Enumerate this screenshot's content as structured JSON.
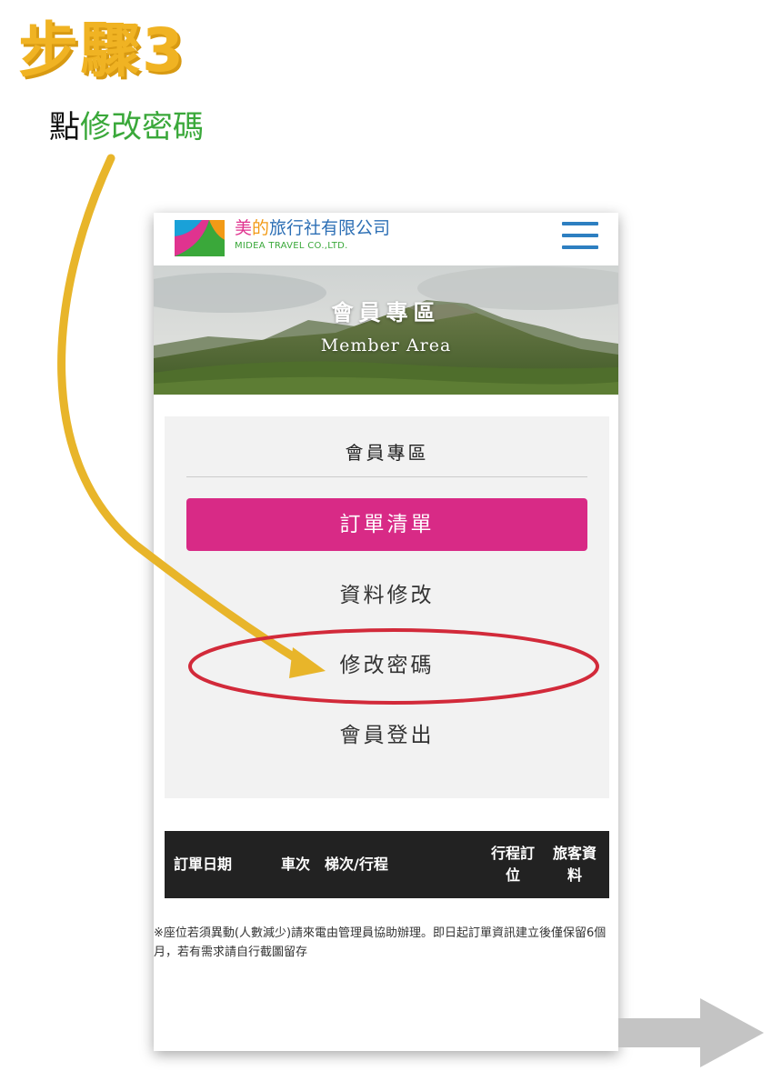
{
  "step": {
    "title": "步驟3"
  },
  "instruction": {
    "prefix": "點",
    "highlight": "修改密碼"
  },
  "header": {
    "brand_part1": "美",
    "brand_part2": "的",
    "brand_part3": "旅行社有限公司",
    "brand_en": "MIDEA TRAVEL  CO.,LTD.",
    "menu_icon": "hamburger-menu-icon"
  },
  "hero": {
    "title": "會員專區",
    "subtitle": "Member Area"
  },
  "member_menu": {
    "heading": "會員專區",
    "items": [
      {
        "label": "訂單清單",
        "active": true
      },
      {
        "label": "資料修改",
        "active": false
      },
      {
        "label": "修改密碼",
        "active": false
      },
      {
        "label": "會員登出",
        "active": false
      }
    ]
  },
  "order_table": {
    "columns": [
      "訂單日期",
      "車次",
      "梯次/行程",
      "行程訂位",
      "旅客資料"
    ]
  },
  "note": "※座位若須異動(人數減少)請來電由管理員協助辦理。即日起訂單資訊建立後僅保留6個月，若有需求請自行截圖留存",
  "colors": {
    "step_title": "#f0b323",
    "highlight_text": "#3aa83a",
    "active_menu": "#d82a86",
    "annotation_circle": "#d22a3a",
    "annotation_arrow": "#e8b52a",
    "table_header": "#222222"
  }
}
